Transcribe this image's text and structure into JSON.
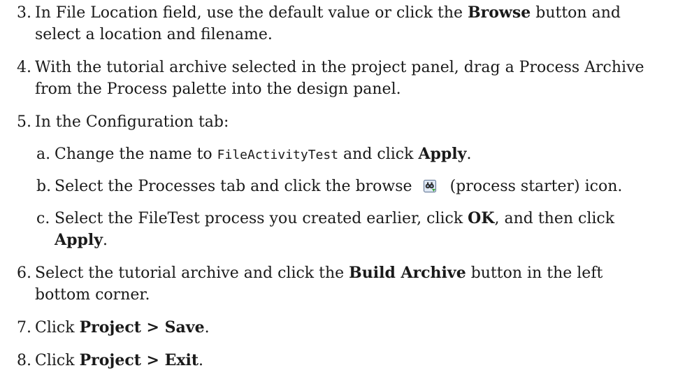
{
  "steps": [
    {
      "num": "3.",
      "line1_pre": "In File Location field, use the default value or click the ",
      "line1_bold": "Browse",
      "line1_post": " button and",
      "line2": "select a location and filename."
    },
    {
      "num": "4.",
      "line1": "With the tutorial archive selected in the project panel, drag a Process Archive",
      "line2": "from the Process palette into the design panel."
    },
    {
      "num": "5.",
      "text": "In the Configuration tab:",
      "subs": [
        {
          "letter": "a.",
          "pre": "Change the name to ",
          "code": "FileActivityTest",
          "mid": " and click ",
          "bold": "Apply",
          "post": "."
        },
        {
          "letter": "b.",
          "pre": "Select the Processes tab and click the browse",
          "icon": "process-starter-browse-icon",
          "post": "(process starter) icon."
        },
        {
          "letter": "c.",
          "pre": "Select the FileTest process you created earlier, click ",
          "bold1": "OK",
          "mid": ", and then click",
          "bold2": "Apply",
          "post": "."
        }
      ]
    },
    {
      "num": "6.",
      "pre": "Select the tutorial archive and click the ",
      "bold": "Build Archive",
      "post": " button in the left",
      "line2": "bottom corner."
    },
    {
      "num": "7.",
      "pre": "Click ",
      "bold": "Project > Save",
      "post": "."
    },
    {
      "num": "8.",
      "pre": "Click ",
      "bold": "Project > Exit",
      "post": "."
    }
  ]
}
